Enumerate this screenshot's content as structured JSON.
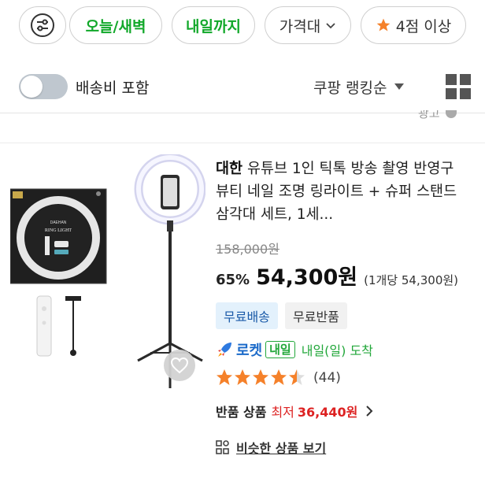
{
  "filters": {
    "chips": [
      {
        "label": "오늘/새벽"
      },
      {
        "label": "내일까지"
      },
      {
        "label": "가격대"
      },
      {
        "label": "4점 이상"
      }
    ]
  },
  "toolbar": {
    "shipping_toggle_label": "배송비 포함",
    "shipping_toggle_on": false,
    "sort_label": "쿠팡 랭킹순"
  },
  "ad_label": "광고",
  "product": {
    "brand": "대한",
    "title": "유튜브 1인 틱톡 방송 촬영 반영구 뷰티 네일 조명 링라이트 + 슈퍼 스탠드 삼각대 세트, 1세...",
    "image_text": {
      "brand": "DAEHAN",
      "name": "RING LIGHT"
    },
    "original_price": "158,000원",
    "discount": "65%",
    "price": "54,300원",
    "unit_price": "(1개당 54,300원)",
    "badges": [
      "무료배송",
      "무료반품"
    ],
    "rocket": {
      "label": "로켓",
      "tag": "내일",
      "delivery": "내일(일) 도착"
    },
    "rating": 4.5,
    "review_count": "(44)",
    "returned": {
      "label": "반품 상품",
      "min_label": "최저",
      "min_price": "36,440원"
    },
    "similar_label": "비슷한 상품 보기"
  },
  "colors": {
    "green": "#12a82a",
    "rocket_blue": "#1b6ac9",
    "star": "#f5812a",
    "sale_red": "#d22222"
  }
}
